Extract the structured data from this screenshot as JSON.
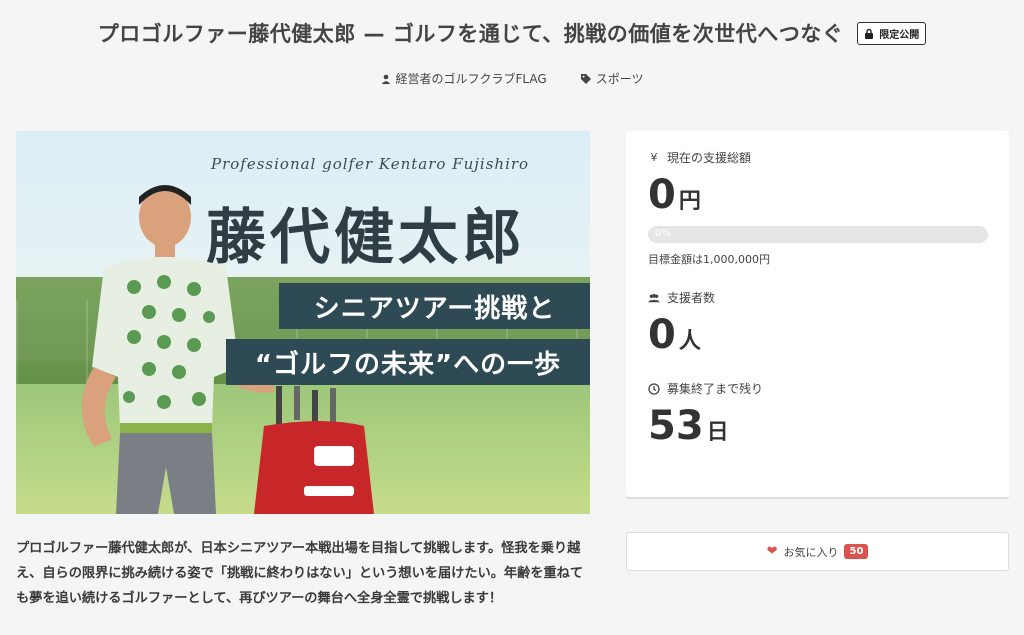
{
  "project": {
    "title": "プロゴルファー藤代健太郎 — ゴルフを通じて、挑戦の価値を次世代へつなぐ",
    "badge": "限定公開",
    "owner": "経営者のゴルフクラブFLAG",
    "category": "スポーツ"
  },
  "hero": {
    "script_text": "Professional golfer Kentaro Fujishiro",
    "name": "藤代健太郎",
    "line1": "シニアツアー挑戦と",
    "line2": "“ゴルフの未来”への一歩"
  },
  "description": "プロゴルファー藤代健太郎が、日本シニアツアー本戦出場を目指して挑戦します。怪我を乗り越え、自らの限界に挑み続ける姿で「挑戦に終わりはない」という想いを届けたい。年齢を重ねても夢を追い続けるゴルファーとして、再びツアーの舞台へ全身全霊で挑戦します！",
  "stats": {
    "total": {
      "label": "現在の支援総額",
      "value": "0",
      "unit": "円",
      "icon": "yen-icon"
    },
    "progress": {
      "percent_text": "0%",
      "fraction": 0
    },
    "goal_text": "目標金額は1,000,000円",
    "supporters": {
      "label": "支援者数",
      "value": "0",
      "unit": "人",
      "icon": "users-icon"
    },
    "remaining": {
      "label": "募集終了まで残り",
      "value": "53",
      "unit": "日",
      "icon": "clock-icon"
    }
  },
  "favorite": {
    "label": "お気に入り",
    "count": "50"
  },
  "colors": {
    "accent": "#d9534f",
    "banner": "#2d4a55"
  }
}
